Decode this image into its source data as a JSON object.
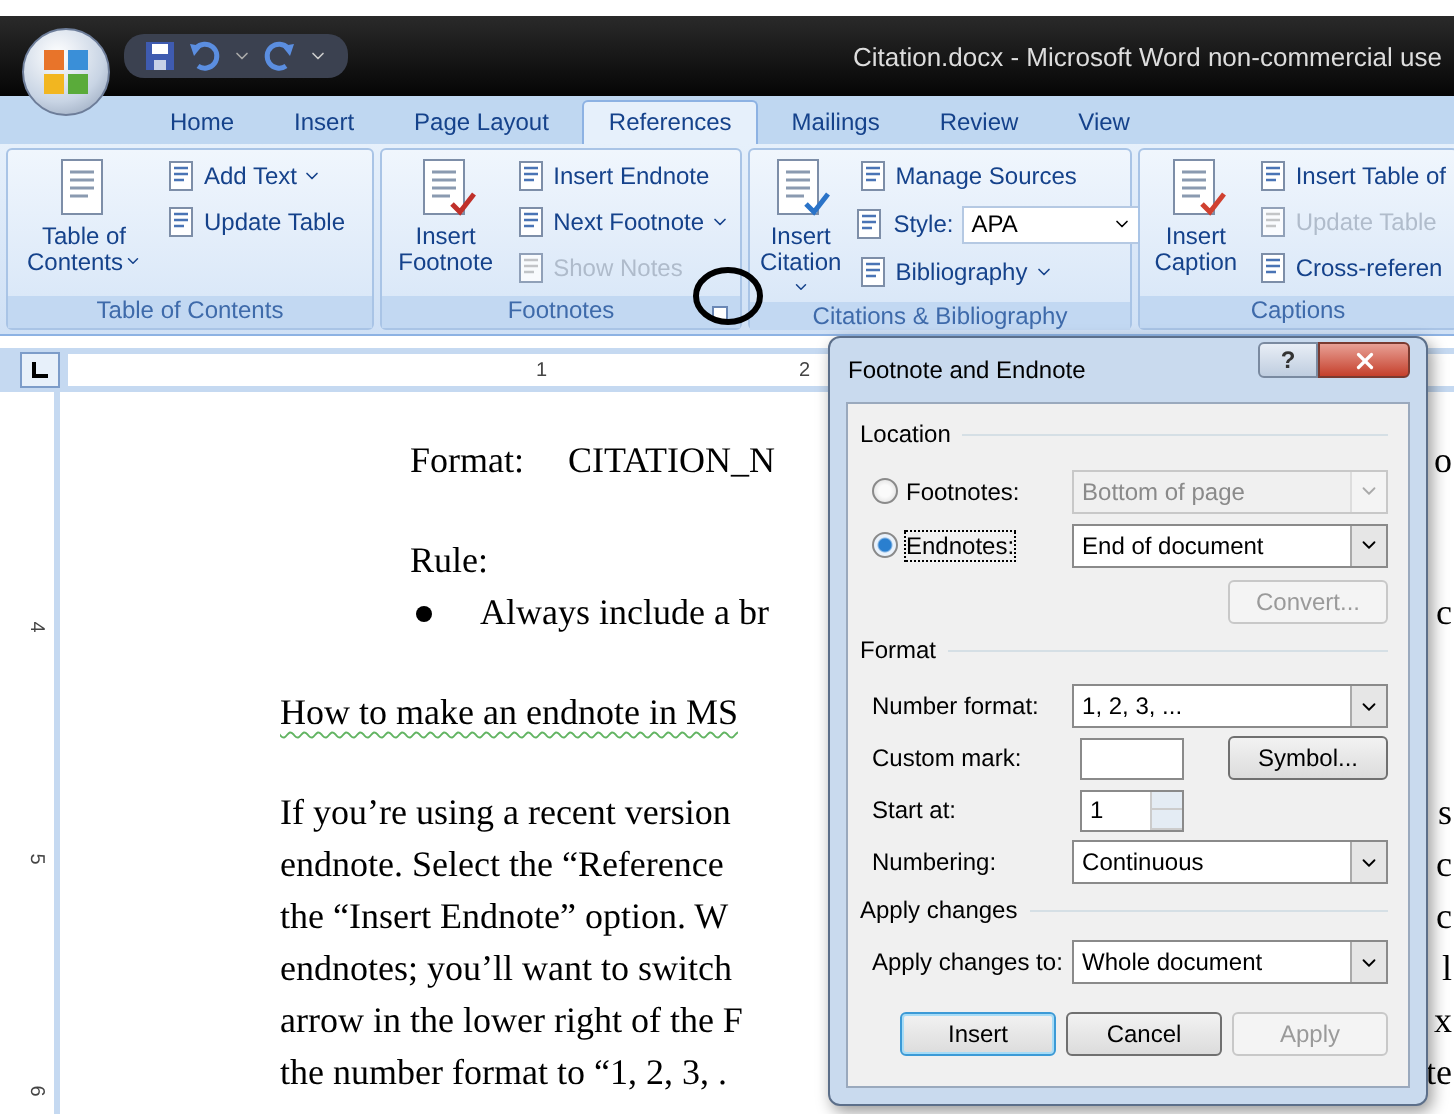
{
  "window": {
    "title": "Citation.docx - Microsoft Word non-commercial use"
  },
  "tabs": [
    {
      "label": "Home",
      "selected": false
    },
    {
      "label": "Insert",
      "selected": false
    },
    {
      "label": "Page Layout",
      "selected": false
    },
    {
      "label": "References",
      "selected": true
    },
    {
      "label": "Mailings",
      "selected": false
    },
    {
      "label": "Review",
      "selected": false
    },
    {
      "label": "View",
      "selected": false
    }
  ],
  "ribbon": {
    "groups": [
      {
        "title": "Table of Contents",
        "launcher": false,
        "large": [
          {
            "label": "Table of Contents",
            "dropdown": true
          }
        ],
        "small": [
          {
            "label": "Add Text",
            "dropdown": true,
            "disabled": false
          },
          {
            "label": "Update Table",
            "dropdown": false,
            "disabled": false
          }
        ]
      },
      {
        "title": "Footnotes",
        "launcher": true,
        "large": [
          {
            "label": "Insert Footnote",
            "dropdown": false
          }
        ],
        "small": [
          {
            "label": "Insert Endnote",
            "dropdown": false,
            "disabled": false
          },
          {
            "label": "Next Footnote",
            "dropdown": true,
            "disabled": false
          },
          {
            "label": "Show Notes",
            "dropdown": false,
            "disabled": true
          }
        ]
      },
      {
        "title": "Citations & Bibliography",
        "launcher": false,
        "large": [
          {
            "label": "Insert Citation",
            "dropdown": true
          }
        ],
        "small": [
          {
            "label": "Manage Sources",
            "dropdown": false,
            "disabled": false
          },
          {
            "label": "Style:",
            "value": "APA"
          },
          {
            "label": "Bibliography",
            "dropdown": true,
            "disabled": false
          }
        ]
      },
      {
        "title": "Captions",
        "launcher": false,
        "large": [
          {
            "label": "Insert Caption",
            "dropdown": false
          }
        ],
        "small": [
          {
            "label": "Insert Table of",
            "dropdown": false,
            "disabled": false
          },
          {
            "label": "Update Table",
            "dropdown": false,
            "disabled": true
          },
          {
            "label": "Cross-referen",
            "dropdown": false,
            "disabled": false
          }
        ]
      }
    ]
  },
  "ruler": {
    "marks": [
      "1",
      "2"
    ],
    "vertical_marks": [
      "4",
      "5",
      "6"
    ]
  },
  "document": {
    "format_label": "Format:",
    "format_value": "CITATION_N",
    "rule_label": "Rule:",
    "bullet": "Always include a br",
    "heading": "How to make an endnote in MS",
    "lines": [
      "If you’re using a recent version",
      "endnote.  Select the “Reference",
      "the “Insert Endnote” option.  W",
      "endnotes; you’ll want to switch",
      "arrow in the lower right of the F",
      "the number format to “1, 2, 3, ."
    ],
    "right_edge": [
      "o",
      "c",
      "s",
      "c",
      "c",
      "l",
      "x",
      "te"
    ]
  },
  "dialog": {
    "title": "Footnote and Endnote",
    "help": "?",
    "location": {
      "title": "Location",
      "options": [
        {
          "label": "Footnotes:",
          "selected": false,
          "value": "Bottom of page"
        },
        {
          "label": "Endnotes:",
          "selected": true,
          "value": "End of document"
        }
      ],
      "convert": {
        "label": "Convert...",
        "disabled": true
      }
    },
    "format": {
      "title": "Format",
      "number_format": {
        "label": "Number format:",
        "value": "1, 2, 3, ..."
      },
      "custom_mark": {
        "label": "Custom mark:"
      },
      "symbol": "Symbol...",
      "start_at": {
        "label": "Start at:",
        "value": "1"
      },
      "numbering": {
        "label": "Numbering:",
        "value": "Continuous"
      }
    },
    "apply_changes": {
      "title": "Apply changes",
      "label": "Apply changes to:",
      "value": "Whole document"
    },
    "buttons": [
      {
        "label": "Insert",
        "default": true,
        "disabled": false
      },
      {
        "label": "Cancel",
        "default": false,
        "disabled": false
      },
      {
        "label": "Apply",
        "default": false,
        "disabled": true
      }
    ]
  }
}
